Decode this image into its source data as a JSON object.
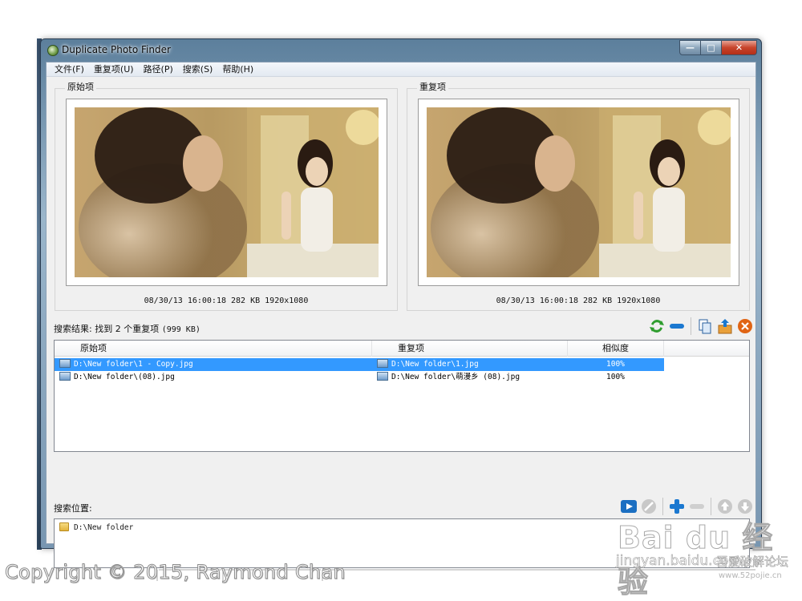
{
  "window": {
    "title": "Duplicate Photo Finder",
    "buttons": {
      "minimize": "—",
      "maximize": "□",
      "close": "✕"
    }
  },
  "menu": [
    "文件(F)",
    "重复项(U)",
    "路径(P)",
    "搜索(S)",
    "帮助(H)"
  ],
  "original_panel": {
    "caption": "原始项",
    "info": "08/30/13 16:00:18   282 KB   1920x1080"
  },
  "duplicate_panel": {
    "caption": "重复项",
    "info": "08/30/13 16:00:18   282 KB   1920x1080"
  },
  "results": {
    "label_prefix": "搜索结果: 找到 2 个重复项 ",
    "label_size": "(999 KB)",
    "toolbar_icons": [
      "refresh-icon",
      "minus-icon",
      "copy-icon",
      "move-icon",
      "delete-icon"
    ],
    "columns": [
      "原始项",
      "重复项",
      "相似度"
    ],
    "rows": [
      {
        "original": "D:\\New folder\\1 - Copy.jpg",
        "duplicate": "D:\\New folder\\1.jpg",
        "similarity": "100%",
        "selected": true
      },
      {
        "original": "D:\\New folder\\(08).jpg",
        "duplicate": "D:\\New folder\\萌漫乡 (08).jpg",
        "similarity": "100%",
        "selected": false
      }
    ]
  },
  "search_location": {
    "label": "搜索位置:",
    "toolbar_icons": [
      "play-icon",
      "stop-icon",
      "add-icon",
      "remove-icon",
      "up-icon",
      "down-icon"
    ],
    "items": [
      "D:\\New folder"
    ]
  },
  "overlay": {
    "copyright": "Copyright © 2015, Raymond Chan",
    "watermark_main": "Bai du 经验",
    "watermark_url": "jingyan.baidu.com",
    "watermark_forum": "吾爱破解论坛",
    "watermark_site": "www.52pojie.cn"
  },
  "colors": {
    "selection": "#3399ff",
    "accent_green": "#2e9d2e",
    "accent_blue": "#1b78d0",
    "accent_orange": "#e06414"
  }
}
